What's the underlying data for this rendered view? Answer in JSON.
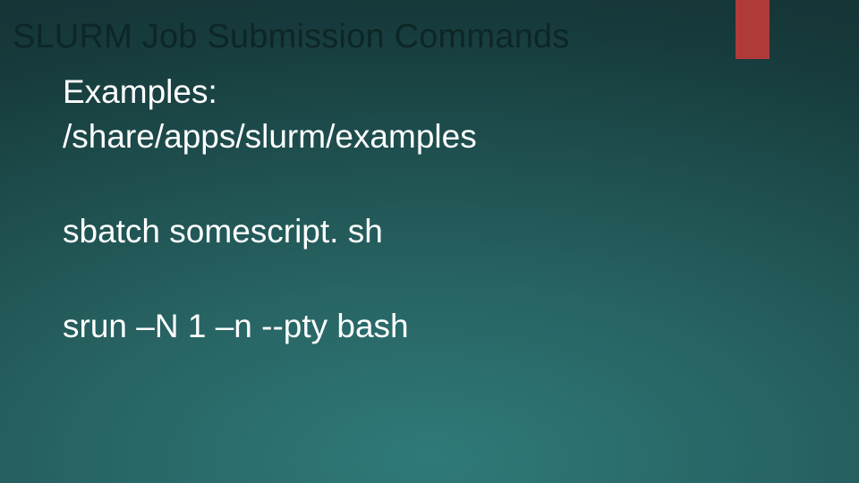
{
  "title": "SLURM Job Submission Commands",
  "lines": {
    "examples_label": "Examples:",
    "examples_path": "/share/apps/slurm/examples",
    "sbatch_cmd": "sbatch somescript. sh",
    "srun_cmd": "srun –N 1 –n --pty bash"
  }
}
